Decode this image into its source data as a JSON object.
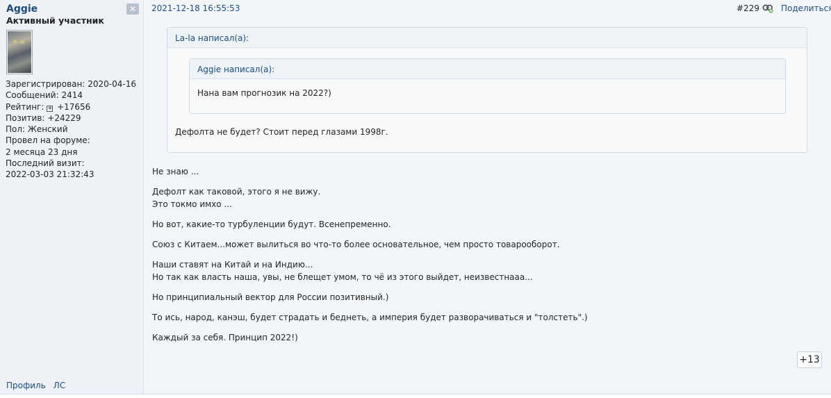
{
  "user": {
    "name": "Aggie",
    "title": "Активный участник",
    "close_glyph": "✕",
    "stats": [
      "Зарегистрирован: 2020-04-16",
      "Сообщений: 2414",
      "+17656",
      "Позитив: +24229",
      "Пол: Женский",
      "Провел на форуме:",
      "2 месяца 23 дня",
      "Последний визит:",
      "2022-03-03 21:32:43"
    ],
    "rating_label": "Рейтинг:",
    "rating_glyph": "+",
    "links": {
      "profile": "Профиль",
      "pm": "ЛС"
    }
  },
  "post": {
    "date": "2021-12-18 16:55:53",
    "number": "#229",
    "share_label": "Поделиться",
    "link_icon": "chain-link-icon",
    "quote_outer": {
      "header": "La-la написал(а):",
      "text": "Дефолта не будет? Стоит перед глазами 1998г."
    },
    "quote_inner": {
      "header": "Aggie написал(а):",
      "text": "Нана вам прогнозик на 2022?)"
    },
    "paragraphs": [
      [
        "Не знаю ..."
      ],
      [
        "Дефолт как таковой, этого я не вижу.",
        "Это токмо имхо ..."
      ],
      [
        "Но вот, какие-то турбуленции будут. Всенепременно."
      ],
      [
        "Союз с Китаем...может вылиться во что-то более основательное, чем просто товарооборот."
      ],
      [
        "Наши ставят на Китай и на Индию...",
        "Но так как власть наша, увы, не блещет умом, то чё из этого выйдет, неизвестнааа..."
      ],
      [
        "Но принципиальный вектор для России позитивный.)"
      ],
      [
        "То ись, народ, канэш, будет страдать и беднеть, а империя будет разворачиваться и \"толстеть\".)"
      ],
      [
        "Каждый за себя. Принцип 2022!)"
      ]
    ],
    "rating": "+13"
  },
  "colors": {
    "link": "#1d4c7a",
    "sidebar_bg": "#eef2f6",
    "quote_border": "#cfdae6"
  }
}
